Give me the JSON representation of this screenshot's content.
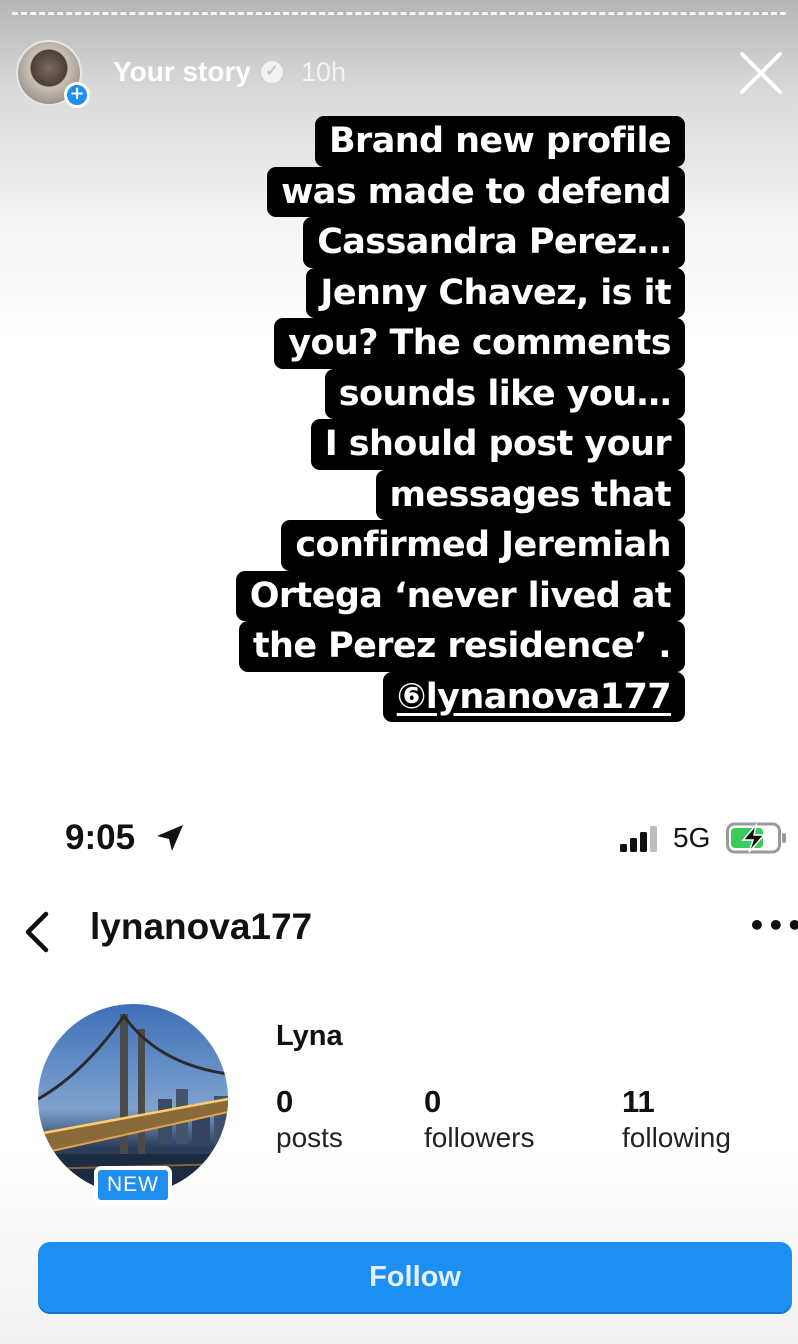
{
  "story": {
    "username": "Your story",
    "time": "10h"
  },
  "caption": {
    "lines": [
      "Brand new profile",
      "was made to defend",
      "Cassandra Perez…",
      "Jenny Chavez, is it",
      "you? The comments",
      "sounds like you…",
      "I should post your",
      "messages that",
      "confirmed Jeremiah",
      "Ortega ‘never lived at",
      "the Perez residence’ ."
    ],
    "mention": "⑥lynanova177"
  },
  "statusbar": {
    "time": "9:05",
    "network": "5G"
  },
  "profile": {
    "username": "lynanova177",
    "badge": "NEW",
    "display_name": "Lyna",
    "stats": [
      {
        "value": "0",
        "label": "posts"
      },
      {
        "value": "0",
        "label": "followers"
      },
      {
        "value": "11",
        "label": "following"
      }
    ],
    "follow_label": "Follow"
  },
  "colors": {
    "accent": "#1e8ff2",
    "caption_bg": "#000000"
  }
}
